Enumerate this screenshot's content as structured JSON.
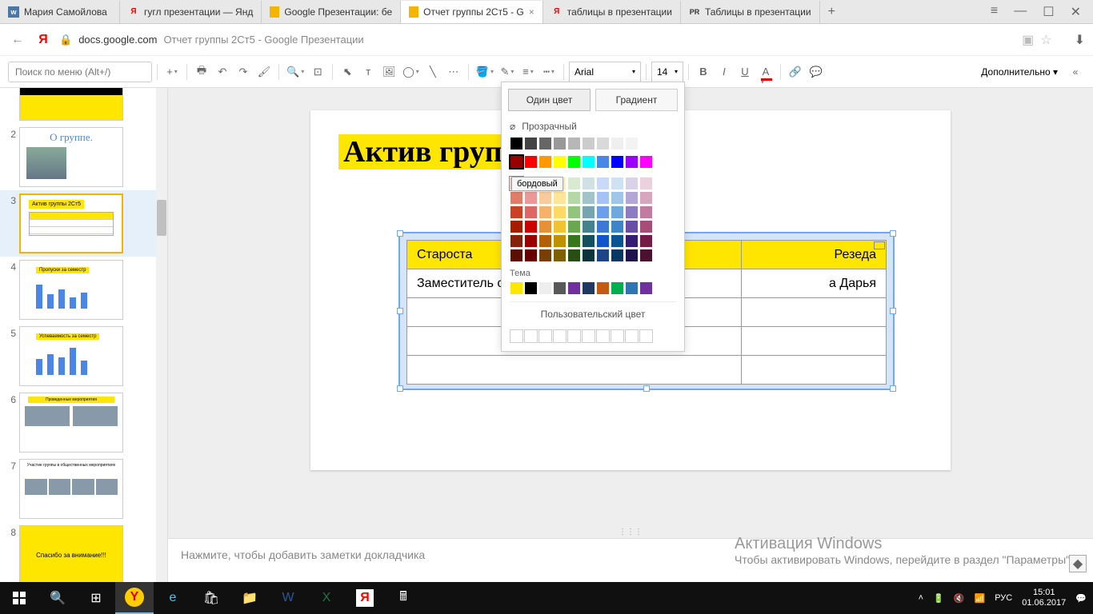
{
  "browser": {
    "tabs": [
      {
        "icon": "vk",
        "label": "Мария Самойлова"
      },
      {
        "icon": "Я",
        "label": "гугл презентации — Янд"
      },
      {
        "icon": "slides",
        "label": "Google Презентации: бе"
      },
      {
        "icon": "slides",
        "label": "Отчет группы 2Ст5 - G",
        "active": true
      },
      {
        "icon": "Я",
        "label": "таблицы в презентации"
      },
      {
        "icon": "PR",
        "label": "Таблицы в презентации"
      }
    ],
    "domain": "docs.google.com",
    "title": "Отчет группы 2Ст5 - Google Презентации"
  },
  "toolbar": {
    "search_placeholder": "Поиск по меню (Alt+/)",
    "font": "Arial",
    "size": "14",
    "more": "Дополнительно"
  },
  "thumbnails": [
    {
      "n": "1",
      "kind": "t1"
    },
    {
      "n": "2",
      "kind": "t2",
      "title": "О группе."
    },
    {
      "n": "3",
      "kind": "t3",
      "active": true,
      "title": "Актив группы 2Ст5"
    },
    {
      "n": "4",
      "kind": "t4",
      "title": "Пропуски за семестр"
    },
    {
      "n": "5",
      "kind": "t5",
      "title": "Успеваемость за семестр"
    },
    {
      "n": "6",
      "kind": "t6",
      "title": "Проведенные мероприятия"
    },
    {
      "n": "7",
      "kind": "t7",
      "title": "Участие группы в общественных мероприятиях"
    },
    {
      "n": "8",
      "kind": "t8",
      "title": "Спасибо за внимание!!!"
    }
  ],
  "slide": {
    "title": "Актив группы",
    "table": [
      [
        "Староста",
        "Резеда"
      ],
      [
        "Заместитель старосты",
        "Дарья"
      ],
      [
        "",
        ""
      ],
      [
        "",
        ""
      ],
      [
        "",
        ""
      ]
    ]
  },
  "notes_placeholder": "Нажмите, чтобы добавить заметки докладчика",
  "color_panel": {
    "tab1": "Один цвет",
    "tab2": "Градиент",
    "transparent": "Прозрачный",
    "theme": "Тема",
    "custom": "Пользовательский цвет",
    "tooltip": "бордовый",
    "greys": [
      "#000000",
      "#434343",
      "#666666",
      "#999999",
      "#b7b7b7",
      "#cccccc",
      "#d9d9d9",
      "#efefef",
      "#f3f3f3",
      "#ffffff"
    ],
    "base": [
      "#980000",
      "#ff0000",
      "#ff9900",
      "#ffff00",
      "#00ff00",
      "#00ffff",
      "#4a86e8",
      "#0000ff",
      "#9900ff",
      "#ff00ff"
    ],
    "shades": [
      [
        "#e6b8af",
        "#f4cccc",
        "#fce5cd",
        "#fff2cc",
        "#d9ead3",
        "#d0e0e3",
        "#c9daf8",
        "#cfe2f3",
        "#d9d2e9",
        "#ead1dc"
      ],
      [
        "#dd7e6b",
        "#ea9999",
        "#f9cb9c",
        "#ffe599",
        "#b6d7a8",
        "#a2c4c9",
        "#a4c2f4",
        "#9fc5e8",
        "#b4a7d6",
        "#d5a6bd"
      ],
      [
        "#cc4125",
        "#e06666",
        "#f6b26b",
        "#ffd966",
        "#93c47d",
        "#76a5af",
        "#6d9eeb",
        "#6fa8dc",
        "#8e7cc3",
        "#c27ba0"
      ],
      [
        "#a61c00",
        "#cc0000",
        "#e69138",
        "#f1c232",
        "#6aa84f",
        "#45818e",
        "#3c78d8",
        "#3d85c6",
        "#674ea7",
        "#a64d79"
      ],
      [
        "#85200c",
        "#990000",
        "#b45f06",
        "#bf9000",
        "#38761d",
        "#134f5c",
        "#1155cc",
        "#0b5394",
        "#351c75",
        "#741b47"
      ],
      [
        "#5b0f00",
        "#660000",
        "#783f04",
        "#7f6000",
        "#274e13",
        "#0c343d",
        "#1c4587",
        "#073763",
        "#20124d",
        "#4c1130"
      ]
    ],
    "theme_colors": [
      "#ffe600",
      "#000000",
      "#eeeeee",
      "#595959",
      "#7030a0",
      "#203864",
      "#c55a11",
      "#00b050",
      "#2e75b6",
      "#7030a0"
    ]
  },
  "watermark": {
    "title": "Активация Windows",
    "line": "Чтобы активировать Windows, перейдите в раздел \"Параметры\"."
  },
  "taskbar": {
    "lang": "РУС",
    "time": "15:01",
    "date": "01.06.2017"
  }
}
